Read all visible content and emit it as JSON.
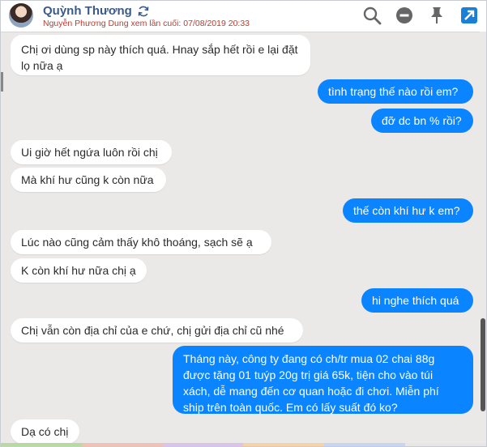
{
  "header": {
    "name": "Quỳnh Thương",
    "last_seen": "Nguyễn Phương Dung xem lần cuối: 07/08/2019 20:33",
    "icons": [
      "search-icon",
      "minus-circle-icon",
      "pin-icon",
      "open-external-icon"
    ]
  },
  "messages": [
    {
      "dir": "in",
      "text": "Chị ơi dùng sp này thích quá. Hnay sắp hết rồi e lại đặt lọ nữa ạ"
    },
    {
      "dir": "out",
      "text": "tình trạng thế nào rồi em?"
    },
    {
      "dir": "out",
      "text": "đỡ dc bn % rồi?"
    },
    {
      "dir": "in",
      "text": "Ui giờ hết ngứa luôn rồi chị"
    },
    {
      "dir": "in",
      "text": "Mà khí hư cũng k còn nữa"
    },
    {
      "dir": "out",
      "text": "thế còn khí hư k em?"
    },
    {
      "dir": "in",
      "text": "Lúc nào cũng cảm thấy khô thoáng, sạch sẽ ạ"
    },
    {
      "dir": "in",
      "text": "K còn khí hư nữa chị ạ"
    },
    {
      "dir": "out",
      "text": "hi nghe thích quá"
    },
    {
      "dir": "in",
      "text": "Chị vẫn còn địa chỉ của e chứ, chị gửi địa chỉ cũ nhé"
    },
    {
      "dir": "out",
      "text": "Tháng này, công ty đang có ch/tr mua 02 chai 88g được tặng 01 tuýp 20g trị giá 65k, tiện cho vào túi xách, dễ mang đến cơ quan hoặc đi chơi. Miễn phí ship trên toàn quốc. Em có lấy suất đó ko?"
    },
    {
      "dir": "in",
      "text": "Dạ có chị"
    }
  ],
  "colors": {
    "outgoing": "#0b84ff",
    "incoming": "#ffffff",
    "background": "#ebe9e7",
    "header_name": "#3a5a8c",
    "last_seen": "#c0392b",
    "external_icon": "#1a7fd6"
  }
}
